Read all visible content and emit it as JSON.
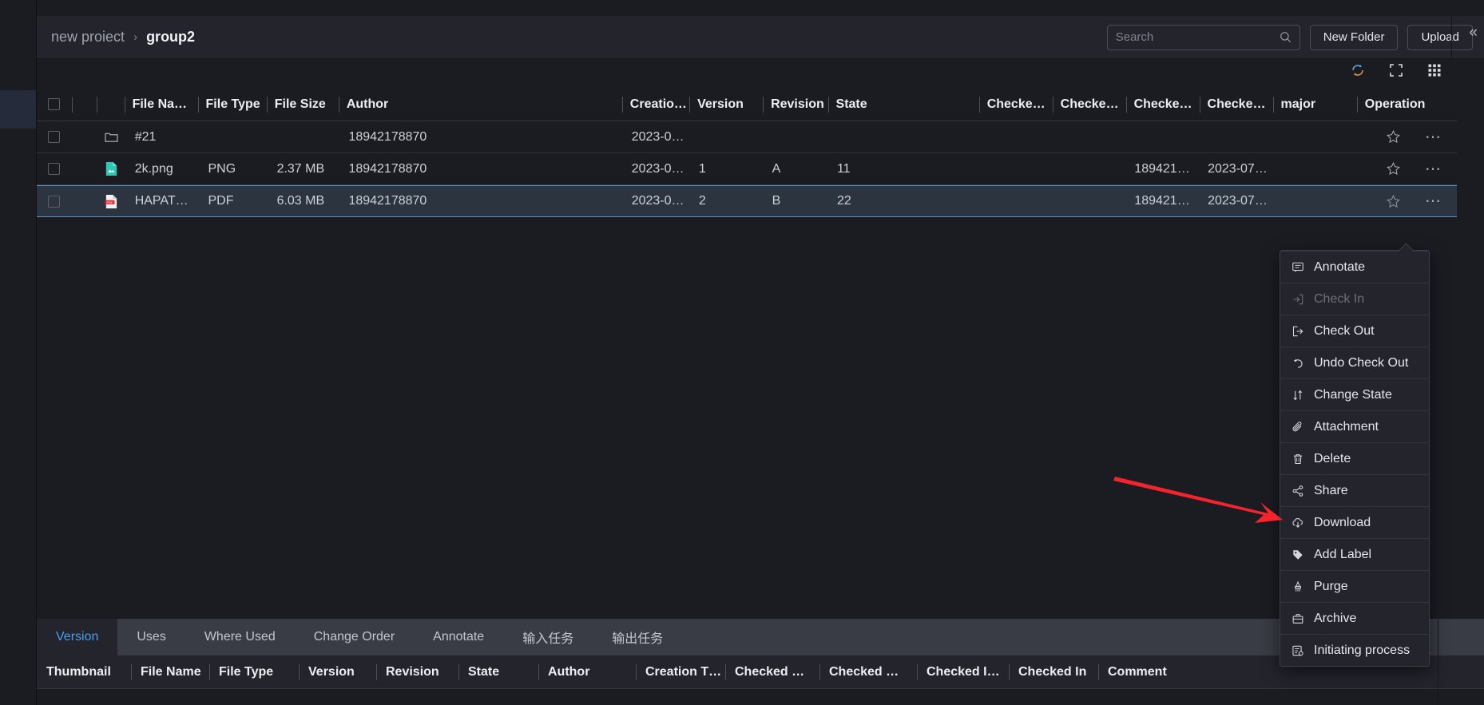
{
  "header": {
    "breadcrumb": {
      "parent": "new proiect",
      "separator": "›",
      "current": "group2"
    },
    "search": {
      "value": "",
      "placeholder": "Search",
      "icon": "search-icon"
    },
    "new_folder_label": "New Folder",
    "upload_label": "Upload",
    "collapse_icon": "«"
  },
  "toolbar": {
    "refresh_icon": "refresh-icon",
    "fullscreen_icon": "fullscreen-icon",
    "grid_view_icon": "grid-view-icon"
  },
  "file_table": {
    "columns": [
      "File Na…",
      "File Type",
      "File Size",
      "Author",
      "Creatio…",
      "Version",
      "Revision",
      "State",
      "Checke…",
      "Checke…",
      "Checke…",
      "Checke…",
      "major",
      "Operation"
    ],
    "rows": [
      {
        "icon": "folder-icon",
        "file_name": "#21",
        "file_type": "",
        "file_size": "",
        "author": "18942178870",
        "creation_time": "2023-0…",
        "version": "",
        "revision": "",
        "state": "",
        "checked1": "",
        "checked2": "",
        "checked3": "",
        "checked4": "",
        "major": "",
        "selected": false
      },
      {
        "icon": "image-file-icon",
        "file_name": "2k.png",
        "file_type": "PNG",
        "file_size": "2.37 MB",
        "author": "18942178870",
        "creation_time": "2023-0…",
        "version": "1",
        "revision": "A",
        "state": "11",
        "checked1": "",
        "checked2": "",
        "checked3": "189421…",
        "checked4": "2023-07…",
        "major": "",
        "selected": false
      },
      {
        "icon": "pdf-file-icon",
        "file_name": "HAPAT…",
        "file_type": "PDF",
        "file_size": "6.03 MB",
        "author": "18942178870",
        "creation_time": "2023-0…",
        "version": "2",
        "revision": "B",
        "state": "22",
        "checked1": "",
        "checked2": "",
        "checked3": "189421…",
        "checked4": "2023-07…",
        "major": "",
        "selected": true
      }
    ],
    "row_actions": {
      "favorite_icon": "star-icon",
      "more_icon": "more-dots-icon"
    }
  },
  "context_menu": {
    "items": [
      {
        "label": "Annotate",
        "icon": "annotate-icon",
        "disabled": false
      },
      {
        "label": "Check In",
        "icon": "check-in-icon",
        "disabled": true
      },
      {
        "label": "Check Out",
        "icon": "check-out-icon",
        "disabled": false
      },
      {
        "label": "Undo Check Out",
        "icon": "undo-icon",
        "disabled": false
      },
      {
        "label": "Change State",
        "icon": "change-state-icon",
        "disabled": false
      },
      {
        "label": "Attachment",
        "icon": "paperclip-icon",
        "disabled": false
      },
      {
        "label": "Delete",
        "icon": "trash-icon",
        "disabled": false
      },
      {
        "label": "Share",
        "icon": "share-icon",
        "disabled": false
      },
      {
        "label": "Download",
        "icon": "download-cloud-icon",
        "disabled": false
      },
      {
        "label": "Add Label",
        "icon": "tag-icon",
        "disabled": false
      },
      {
        "label": "Purge",
        "icon": "brush-icon",
        "disabled": false
      },
      {
        "label": "Archive",
        "icon": "archive-box-icon",
        "disabled": false
      },
      {
        "label": "Initiating process",
        "icon": "initiating-process-icon",
        "disabled": false
      }
    ]
  },
  "annotation": {
    "arrow_color": "#f5232c",
    "points_to": "Download"
  },
  "bottom_panel": {
    "tabs": [
      {
        "label": "Version",
        "active": true
      },
      {
        "label": "Uses",
        "active": false
      },
      {
        "label": "Where Used",
        "active": false
      },
      {
        "label": "Change Order",
        "active": false
      },
      {
        "label": "Annotate",
        "active": false
      },
      {
        "label": "输入任务",
        "active": false
      },
      {
        "label": "输出任务",
        "active": false
      }
    ],
    "columns": [
      "Thumbnail",
      "File Name",
      "File Type",
      "Version",
      "Revision",
      "State",
      "Author",
      "Creation T…",
      "Checked …",
      "Checked …",
      "Checked I…",
      "Checked In",
      "Comment"
    ]
  },
  "colors": {
    "accent": "#4a9df0",
    "selection_border": "#5b93c4",
    "panel_bg": "#23242c",
    "page_bg": "#1b1c22",
    "annotation_red": "#f5232c"
  }
}
